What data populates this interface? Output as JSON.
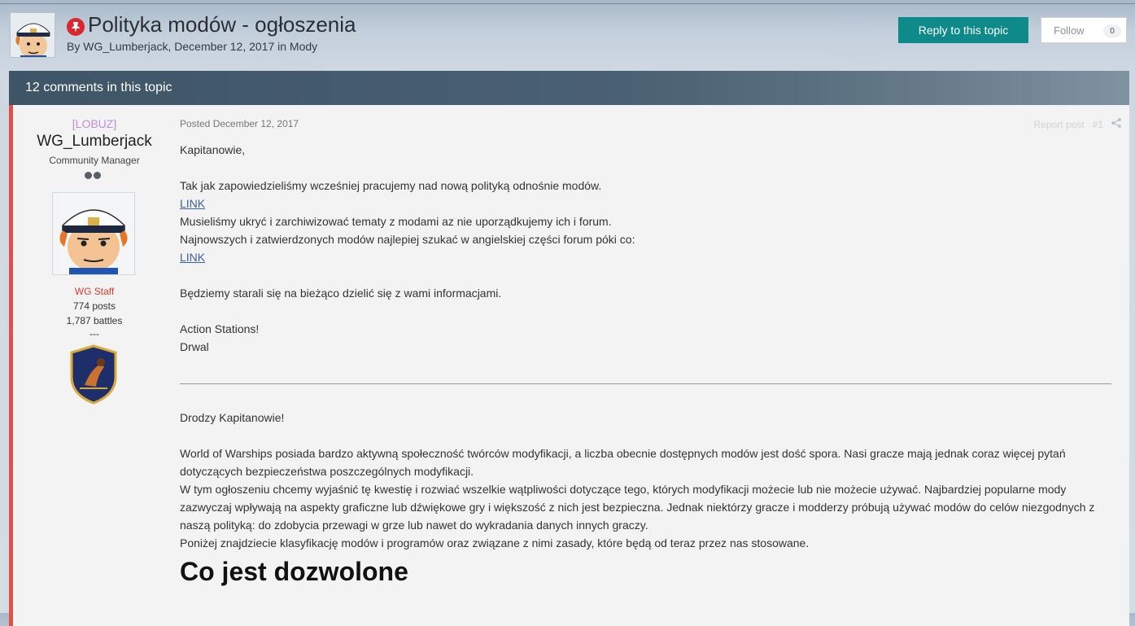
{
  "header": {
    "title": "Polityka modów - ogłoszenia",
    "meta_prefix": "By",
    "meta_author": "WG_Lumberjack",
    "meta_date": ", December 12, 2017 in ",
    "meta_forum": "Mody",
    "reply_label": "Reply to this topic",
    "follow_label": "Follow",
    "follow_count": "0"
  },
  "comments_bar": {
    "text": "12 comments in this topic"
  },
  "author": {
    "rank_tag": "[LOBUZ]",
    "name": "WG_Lumberjack",
    "role": "Community Manager",
    "group": "WG Staff",
    "posts": "774 posts",
    "battles": "1,787 battles",
    "dashes": "---"
  },
  "post": {
    "posted": "Posted December 12, 2017",
    "report": "Report post",
    "number": "#1",
    "greeting": "Kapitanowie,",
    "line1": "Tak jak zapowiedzieliśmy wcześniej pracujemy nad nową polityką odnośnie modów.",
    "link1": "LINK",
    "line2": "Musieliśmy ukryć i zarchiwizować tematy z modami az nie uporządkujemy ich i forum.",
    "line3": "Najnowszych i zatwierdzonych modów najlepiej szukać w angielskiej części forum póki co:",
    "link2": "LINK",
    "line4": "Będziemy starali się na bieżąco dzielić się z wami informacjami.",
    "sign1": "Action Stations!",
    "sign2": "Drwal",
    "greeting2": "Drodzy Kapitanowie!",
    "para1": "World of Warships posiada bardzo aktywną społeczność twórców modyfikacji, a liczba obecnie dostępnych modów jest dość spora. Nasi gracze mają jednak coraz więcej pytań dotyczących bezpieczeństwa poszczególnych modyfikacji.",
    "para2": "W tym ogłoszeniu chcemy wyjaśnić tę kwestię i rozwiać wszelkie wątpliwości dotyczące tego, których modyfikacji możecie lub nie możecie używać. Najbardziej popularne mody zazwyczaj wpływają na aspekty graficzne lub dźwiękowe gry i większość z nich jest bezpieczna. Jednak niektórzy gracze i modderzy próbują używać modów do celów niezgodnych z naszą polityką: do zdobycia przewagi w grze lub nawet do wykradania danych innych graczy.",
    "para3": "Poniżej znajdziecie klasyfikację modów i programów oraz związane z nimi zasady, które będą od teraz przez nas stosowane.",
    "heading": "Co jest dozwolone"
  },
  "colors": {
    "accent_teal": "#0e8a8a",
    "pin_red": "#d9262f",
    "post_border": "#e1514c",
    "rank_purple": "#c28be0",
    "staff_red": "#e23a2e"
  }
}
